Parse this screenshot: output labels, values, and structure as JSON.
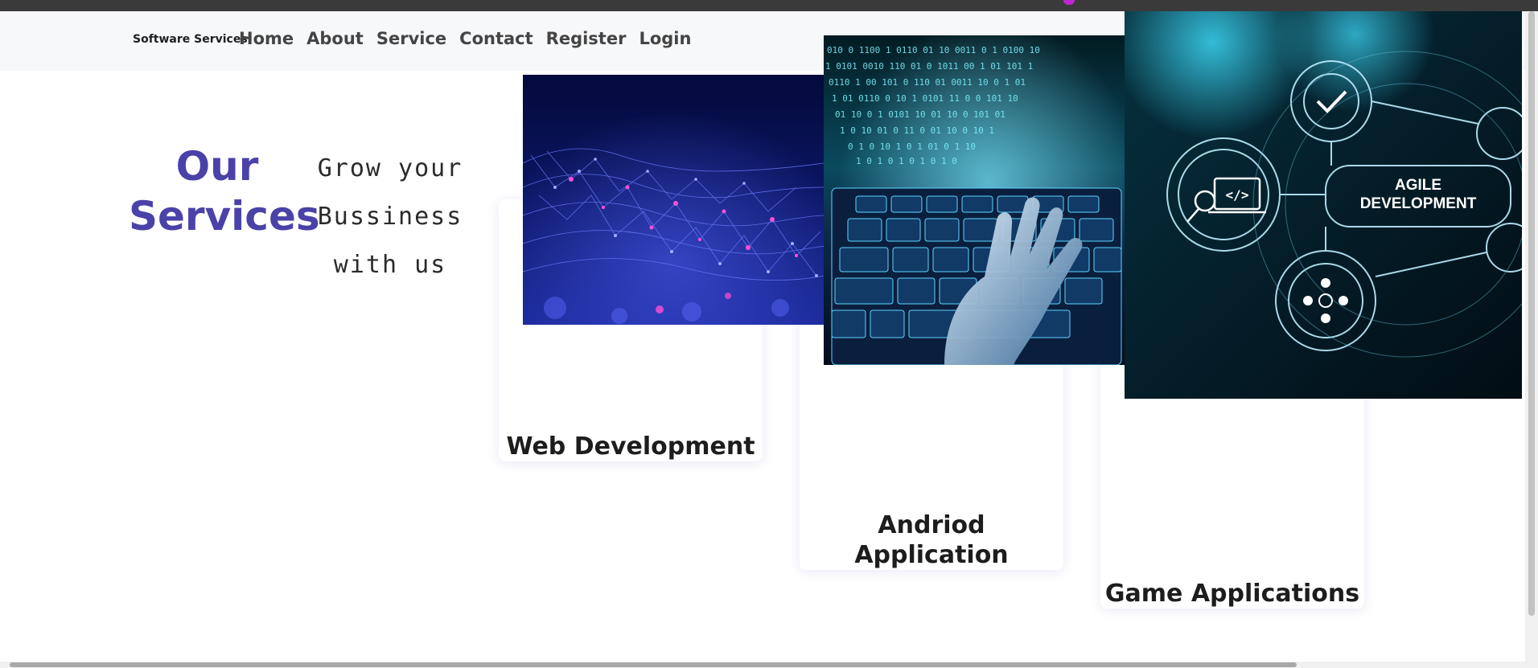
{
  "navbar": {
    "brand": "Software Services",
    "links": [
      "Home",
      "About",
      "Service",
      "Contact",
      "Register",
      "Login"
    ]
  },
  "hero": {
    "title_line1": "Our",
    "title_line2": "Services",
    "subtitle_line1": "Grow your",
    "subtitle_line2": "Bussiness",
    "subtitle_line3": "with us"
  },
  "cards": [
    {
      "title": "Web Development"
    },
    {
      "title_line1": "Andriod",
      "title_line2": "Application"
    },
    {
      "title": "Game Applications"
    }
  ],
  "images": {
    "agile_line1": "AGILE",
    "agile_line2": "DEVELOPMENT"
  },
  "colors": {
    "accent": "#4a42a8",
    "navbar_bg": "#f7f8fa",
    "topbar_bg": "#3a3a3a"
  }
}
